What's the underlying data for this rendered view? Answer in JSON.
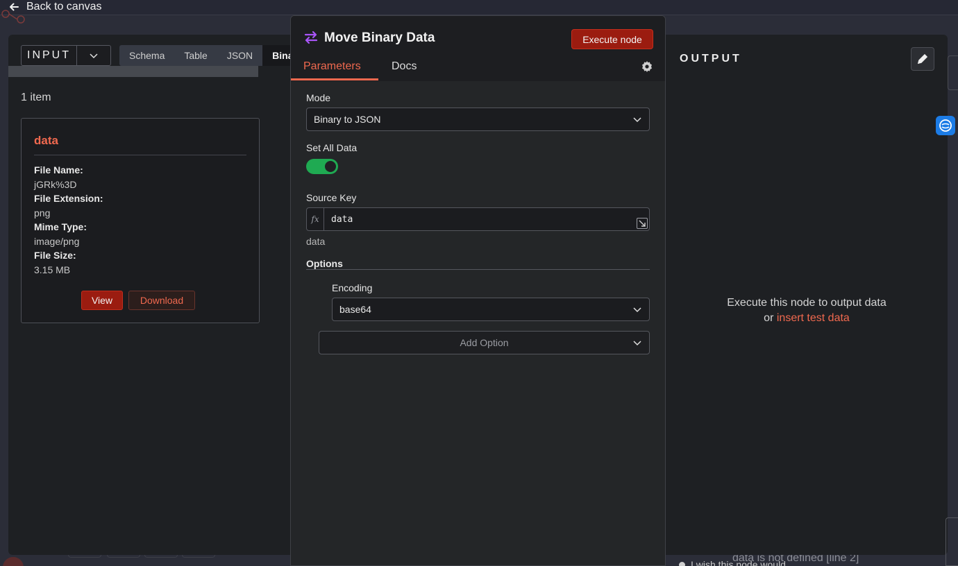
{
  "topbar": {
    "back_label": "Back to canvas"
  },
  "input": {
    "selector_label": "INPUT",
    "tabs": [
      {
        "label": "Schema"
      },
      {
        "label": "Table"
      },
      {
        "label": "JSON"
      },
      {
        "label": "Binary"
      }
    ],
    "item_count": "1 item",
    "card": {
      "title": "data",
      "file_name_label": "File Name:",
      "file_name": "jGRk%3D",
      "file_extension_label": "File Extension:",
      "file_extension": "png",
      "mime_type_label": "Mime Type:",
      "mime_type": "image/png",
      "file_size_label": "File Size:",
      "file_size": "3.15 MB",
      "view_label": "View",
      "download_label": "Download"
    }
  },
  "node": {
    "title": "Move Binary Data",
    "execute_label": "Execute node",
    "tabs": {
      "parameters": "Parameters",
      "docs": "Docs"
    },
    "mode": {
      "label": "Mode",
      "value": "Binary to JSON"
    },
    "set_all_data": {
      "label": "Set All Data",
      "enabled": true
    },
    "source_key": {
      "label": "Source Key",
      "value": "data",
      "hint": "data",
      "fx": "fx"
    },
    "options": {
      "label": "Options",
      "encoding": {
        "label": "Encoding",
        "value": "base64"
      },
      "add_option_label": "Add Option"
    }
  },
  "output": {
    "title": "OUTPUT",
    "message": "Execute this node to output data",
    "or_text": "or",
    "link_text": "insert test data"
  },
  "background": {
    "error_text": "data is not defined [line 2]",
    "wish_text": "I wish this node would..."
  },
  "colors": {
    "accent": "#f0694f",
    "execute_button": "#9b1c10",
    "toggle_on": "#1faa52",
    "node_icon": "#a855f7"
  }
}
